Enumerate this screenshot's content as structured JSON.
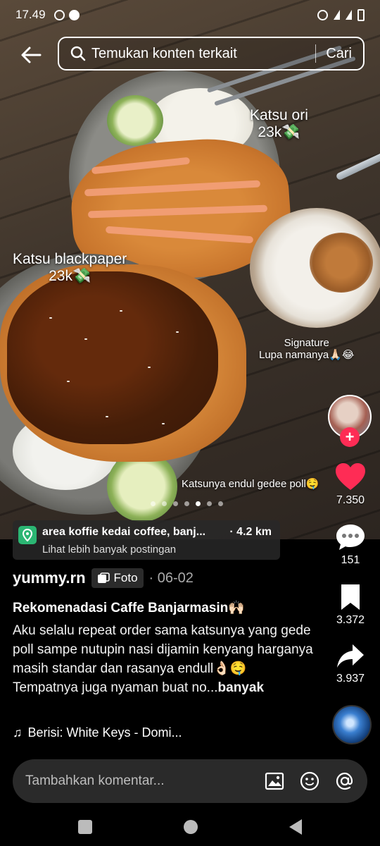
{
  "status_bar": {
    "time": "17.49"
  },
  "search": {
    "placeholder": "Temukan konten terkait",
    "submit": "Cari"
  },
  "photo_captions": {
    "katsu_ori": "Katsu ori",
    "katsu_ori_price": "23k💸",
    "katsu_black": "Katsu blackpaper",
    "katsu_black_price": "23k💸",
    "drink_line1": "Signature",
    "drink_line2": "Lupa namanya🙏🏻😂",
    "bottom_note": "Katsunya endul gedee poll🤤"
  },
  "carousel": {
    "total": 7,
    "active_index": 4
  },
  "actions": {
    "likes": "7.350",
    "comments": "151",
    "saves": "3.372",
    "shares": "3.937"
  },
  "location": {
    "name": "area koffie kedai coffee, banj...",
    "distance": "· 4.2 km",
    "more": "Lihat lebih banyak postingan"
  },
  "post": {
    "username": "yummy.rn",
    "type_label": "Foto",
    "date": "· 06-02",
    "title": "Rekomenadasi Caffe Banjarmasin🙌🏻",
    "description": "Aku selalu repeat order sama katsunya yang gede poll sampe nutupin nasi dijamin kenyang harganya masih standar dan rasanya endull👌🏻🤤 Tempatnya juga nyaman buat no...",
    "more_label": "banyak",
    "music": "Berisi: White Keys - Domi..."
  },
  "comment_bar": {
    "placeholder": "Tambahkan komentar..."
  },
  "colors": {
    "like": "#fe2c55",
    "location_pin": "#2bb673"
  }
}
